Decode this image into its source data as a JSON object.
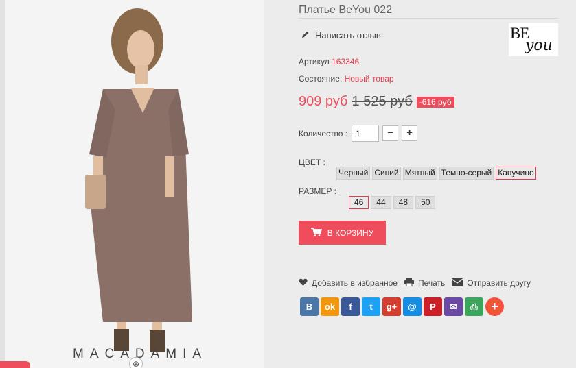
{
  "product": {
    "title": "Платье BeYou 022",
    "write_review": "Написать отзыв",
    "article_label": "Артикул",
    "article_value": "163346",
    "condition_label": "Состояние:",
    "condition_value": "Новый товар",
    "price": "909 руб",
    "old_price": "1 525 руб",
    "discount": "-616 руб"
  },
  "brand_logo": {
    "top": "BE",
    "bottom": "you"
  },
  "photo": {
    "watermark": "MACADAMIA"
  },
  "quantity": {
    "label": "Количество :",
    "value": "1",
    "minus": "−",
    "plus": "+"
  },
  "color": {
    "label": "ЦВЕТ :",
    "options": [
      "Черный",
      "Синий",
      "Мятный",
      "Темно-серый",
      "Капучино"
    ],
    "selected": "Капучино"
  },
  "size": {
    "label": "РАЗМЕР :",
    "options": [
      "46",
      "44",
      "48",
      "50"
    ],
    "selected": "46"
  },
  "cart_button": "В КОРЗИНУ",
  "actions": {
    "favorite": "Добавить в избранное",
    "print": "Печать",
    "send": "Отправить другу"
  },
  "social": [
    {
      "name": "vk",
      "glyph": "B",
      "color": "#4a76a8"
    },
    {
      "name": "odnoklassniki",
      "glyph": "ok",
      "color": "#f2960e"
    },
    {
      "name": "facebook",
      "glyph": "f",
      "color": "#3b5998"
    },
    {
      "name": "twitter",
      "glyph": "t",
      "color": "#1da1f2"
    },
    {
      "name": "google-plus",
      "glyph": "g+",
      "color": "#d23f31"
    },
    {
      "name": "mail",
      "glyph": "@",
      "color": "#168de2"
    },
    {
      "name": "pinterest",
      "glyph": "P",
      "color": "#cb2027"
    },
    {
      "name": "email",
      "glyph": "✉",
      "color": "#6a4aa5"
    },
    {
      "name": "print",
      "glyph": "⎙",
      "color": "#3aa55b"
    },
    {
      "name": "more",
      "glyph": "+",
      "color": "#f0553a"
    }
  ],
  "colors": {
    "accent": "#f04d5c",
    "background": "#ececec"
  }
}
